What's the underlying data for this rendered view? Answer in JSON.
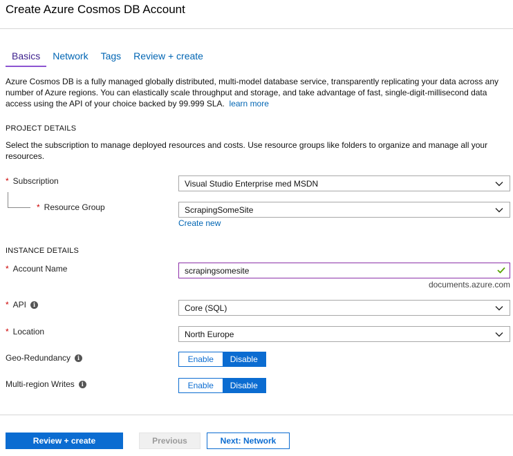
{
  "title": "Create Azure Cosmos DB Account",
  "tabs": [
    {
      "label": "Basics",
      "active": true
    },
    {
      "label": "Network",
      "active": false
    },
    {
      "label": "Tags",
      "active": false
    },
    {
      "label": "Review + create",
      "active": false
    }
  ],
  "description": {
    "text": "Azure Cosmos DB is a fully managed globally distributed, multi-model database service, transparently replicating your data across any number of Azure regions. You can elastically scale throughput and storage, and take advantage of fast, single-digit-millisecond data access using the API of your choice backed by 99.999 SLA.",
    "link": "learn more"
  },
  "project": {
    "heading": "PROJECT DETAILS",
    "text": "Select the subscription to manage deployed resources and costs. Use resource groups like folders to organize and manage all your resources.",
    "subscription": {
      "label": "Subscription",
      "required": "*",
      "value": "Visual Studio Enterprise med MSDN"
    },
    "resource_group": {
      "label": "Resource Group",
      "required": "*",
      "value": "ScrapingSomeSite",
      "create_link": "Create new"
    }
  },
  "instance": {
    "heading": "INSTANCE DETAILS",
    "account_name": {
      "label": "Account Name",
      "required": "*",
      "value": "scrapingsomesite",
      "suffix": "documents.azure.com"
    },
    "api": {
      "label": "API",
      "required": "*",
      "value": "Core (SQL)"
    },
    "location": {
      "label": "Location",
      "required": "*",
      "value": "North Europe"
    },
    "geo_redundancy": {
      "label": "Geo-Redundancy",
      "enable": "Enable",
      "disable": "Disable",
      "selected": "Disable"
    },
    "multi_region": {
      "label": "Multi-region Writes",
      "enable": "Enable",
      "disable": "Disable",
      "selected": "Disable"
    }
  },
  "footer": {
    "review_create": "Review + create",
    "previous": "Previous",
    "next": "Next: Network"
  },
  "colors": {
    "accent": "#0b6cd1",
    "tab_active_border": "#8c54d1",
    "input_focus_border": "#8c2fa8",
    "valid_check": "#57a300",
    "required": "#cc0000"
  },
  "icons": {
    "chevron": "chevron-down-icon",
    "info": "info-icon",
    "check": "checkmark-icon"
  }
}
